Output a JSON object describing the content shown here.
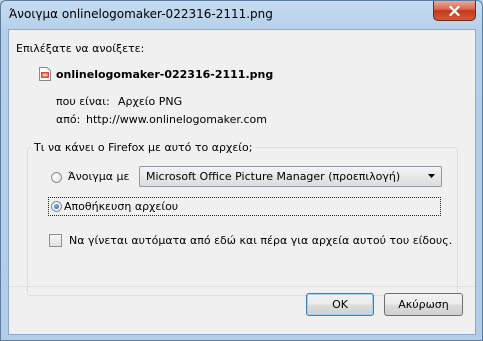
{
  "window": {
    "title": "Άνοιγμα onlinelogomaker-022316-2111.png",
    "close_label": "×"
  },
  "dialog": {
    "prompt": "Επιλέξατε να ανοίξετε:",
    "file_name": "onlinelogomaker-022316-2111.png",
    "type_label": "που είναι:",
    "type_value": "Αρχείο PNG",
    "from_label": "από:",
    "from_value": "http://www.onlinelogomaker.com"
  },
  "group": {
    "legend": "Τι να κάνει ο Firefox  με αυτό το αρχείο;",
    "open_with_label": "Άνοιγμα με",
    "open_with_selected": "Microsoft Office Picture Manager (προεπιλογή)",
    "save_label": "Αποθήκευση αρχείου",
    "save_selected": true,
    "auto_label": "Να γίνεται αυτόματα από εδώ και πέρα για αρχεία αυτού του είδους.",
    "auto_checked": false
  },
  "buttons": {
    "ok": "OK",
    "cancel": "Ακύρωση"
  },
  "icons": {
    "file": "png-file-icon",
    "close": "close-icon",
    "dropdown": "chevron-down-icon"
  }
}
